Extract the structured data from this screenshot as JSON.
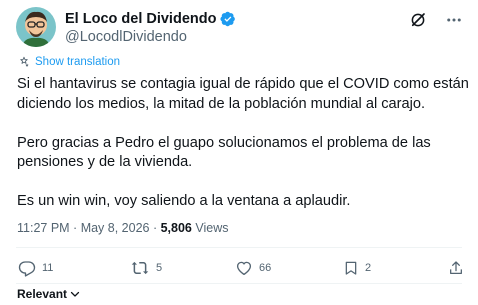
{
  "author": {
    "display_name": "El Loco del Dividendo",
    "handle": "@LocodlDividendo",
    "verified": true
  },
  "top_icons": [
    "grok-icon",
    "more-icon"
  ],
  "translation": {
    "label": "Show translation"
  },
  "tweet": {
    "paragraph1_line1": "Si el hantavirus se contagia igual de rápido que el COVID como están",
    "paragraph1_line2": "diciendo los medios, la mitad de la población mundial al carajo.",
    "paragraph2_line1": "Pero gracias a Pedro el guapo solucionamos el problema de las",
    "paragraph2_line2": "pensiones y de la vivienda.",
    "paragraph3_line1": "Es un win win, voy saliendo a la ventana a aplaudir."
  },
  "meta": {
    "time": "11:27 PM",
    "separator": " · ",
    "date": "May 8, 2026",
    "views_count": "5,806",
    "views_label": " Views"
  },
  "actions": {
    "replies": "11",
    "reposts": "5",
    "likes": "66",
    "bookmarks": "2"
  },
  "sort": {
    "label": "Relevant"
  },
  "colors": {
    "accent": "#1d9bf0",
    "text": "#0f1419",
    "secondary": "#536471",
    "divider": "#eff3f4"
  }
}
